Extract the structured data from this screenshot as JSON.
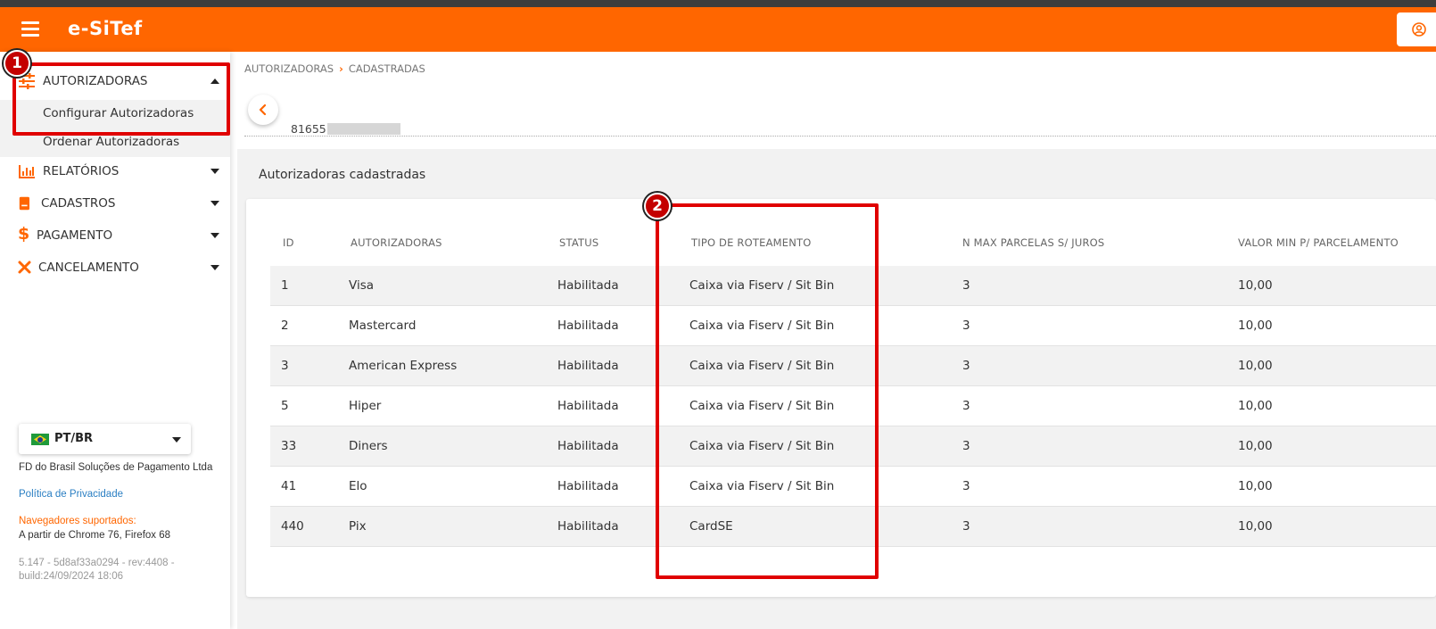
{
  "header": {
    "brand": "e-SiTef"
  },
  "sidebar": {
    "items": [
      {
        "label": "AUTORIZADORAS",
        "icon": "sliders-icon",
        "expanded": true,
        "sub": [
          "Configurar Autorizadoras",
          "Ordenar Autorizadoras"
        ]
      },
      {
        "label": "RELATÓRIOS",
        "icon": "bar-chart-icon"
      },
      {
        "label": "CADASTROS",
        "icon": "book-icon"
      },
      {
        "label": "PAGAMENTO",
        "icon": "dollar-icon"
      },
      {
        "label": "CANCELAMENTO",
        "icon": "x-icon"
      }
    ],
    "language": "PT/BR",
    "company": "FD do Brasil Soluções de Pagamento Ltda",
    "privacy_link": "Política de Privacidade",
    "browsers_title": "Navegadores suportados:",
    "browsers_text": "A partir de Chrome 76, Firefox 68",
    "version_line1": "5.147 - 5d8af33a0294 - rev:4408 -",
    "version_line2": "build:24/09/2024 18:06"
  },
  "breadcrumb": [
    "AUTORIZADORAS",
    "CADASTRADAS"
  ],
  "merchant_code_prefix": "81655",
  "section_title": "Autorizadoras cadastradas",
  "table": {
    "headers": [
      "ID",
      "AUTORIZADORAS",
      "STATUS",
      "TIPO DE ROTEAMENTO",
      "N MAX PARCELAS S/ JUROS",
      "VALOR MIN P/ PARCELAMENTO"
    ],
    "rows": [
      [
        "1",
        "Visa",
        "Habilitada",
        "Caixa via Fiserv / Sit Bin",
        "3",
        "10,00"
      ],
      [
        "2",
        "Mastercard",
        "Habilitada",
        "Caixa via Fiserv / Sit Bin",
        "3",
        "10,00"
      ],
      [
        "3",
        "American Express",
        "Habilitada",
        "Caixa via Fiserv / Sit Bin",
        "3",
        "10,00"
      ],
      [
        "5",
        "Hiper",
        "Habilitada",
        "Caixa via Fiserv / Sit Bin",
        "3",
        "10,00"
      ],
      [
        "33",
        "Diners",
        "Habilitada",
        "Caixa via Fiserv / Sit Bin",
        "3",
        "10,00"
      ],
      [
        "41",
        "Elo",
        "Habilitada",
        "Caixa via Fiserv / Sit Bin",
        "3",
        "10,00"
      ],
      [
        "440",
        "Pix",
        "Habilitada",
        "CardSE",
        "3",
        "10,00"
      ]
    ]
  },
  "annotations": [
    "1",
    "2"
  ],
  "colors": {
    "brand": "#ff6600",
    "annotation": "#e00000"
  }
}
